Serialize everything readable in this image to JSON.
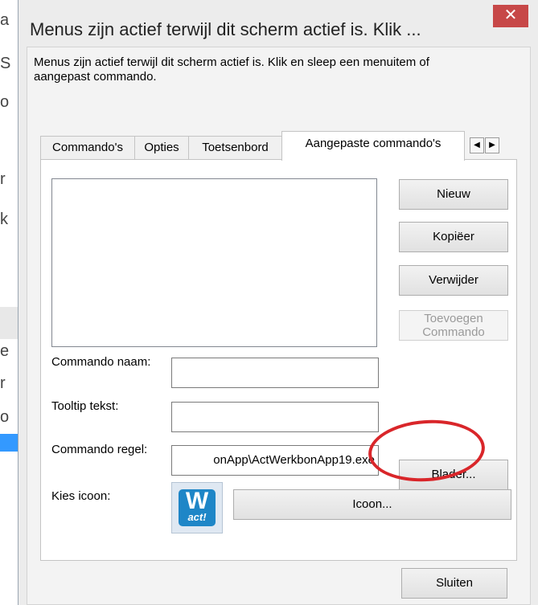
{
  "background": {
    "fragment_chars": [
      "a",
      "S",
      "o",
      "r",
      "k",
      "e",
      "r",
      "o"
    ]
  },
  "dialog": {
    "title": "Menus zijn actief terwijl dit scherm actief is. Klik ...",
    "close_glyph": "✕",
    "intro_text": "Menus zijn actief terwijl dit scherm actief is. Klik en sleep een menuitem of aangepast commando."
  },
  "tabs": [
    {
      "label": "Commando's",
      "active": false
    },
    {
      "label": "Opties",
      "active": false
    },
    {
      "label": "Toetsenbord",
      "active": false
    },
    {
      "label": "Aangepaste commando's",
      "active": true
    }
  ],
  "tab_scroll": {
    "left": "◀",
    "right": "▶"
  },
  "buttons": {
    "nieuw": "Nieuw",
    "kopieer": "Kopiëer",
    "verwijder": "Verwijder",
    "toevoegen": "Toevoegen Commando",
    "blader": "Blader...",
    "icoon": "Icoon...",
    "sluiten": "Sluiten"
  },
  "form": {
    "commando_naam_label": "Commando naam:",
    "commando_naam_value": "",
    "tooltip_label": "Tooltip tekst:",
    "tooltip_value": "",
    "commando_regel_label": "Commando regel:",
    "commando_regel_value": "onApp\\ActWerkbonApp19.exe",
    "kies_icoon_label": "Kies icoon:"
  },
  "icon": {
    "name": "act-app-icon",
    "letter": "W",
    "text": "act!",
    "color": "#1e86c7"
  },
  "annotation_color": "#d9262a"
}
